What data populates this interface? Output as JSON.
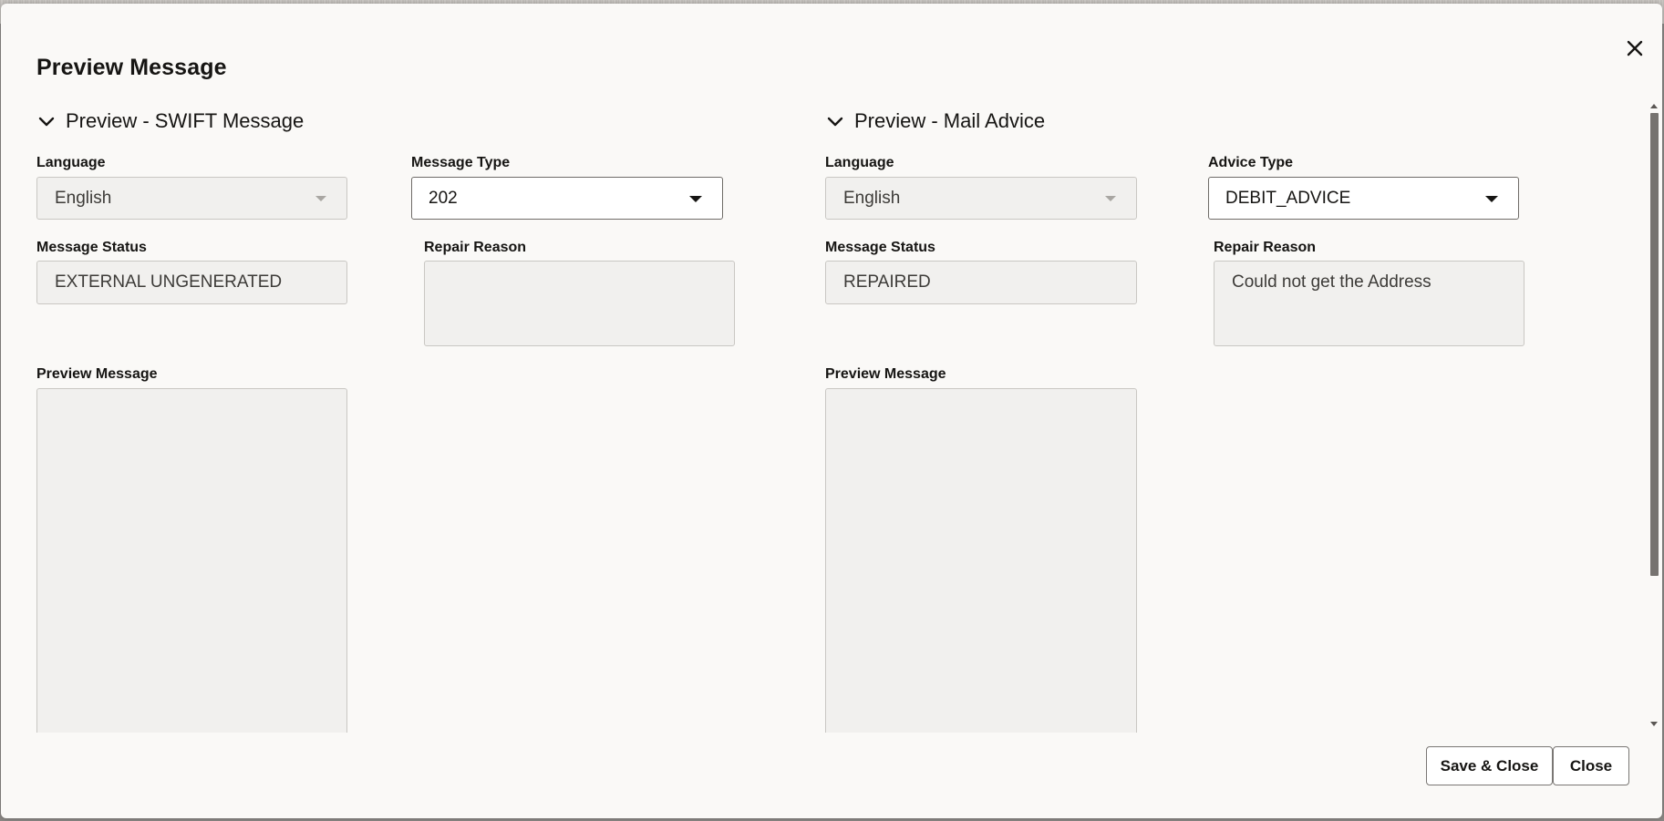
{
  "dialog": {
    "title": "Preview Message"
  },
  "swift": {
    "section_title": "Preview - SWIFT Message",
    "language_label": "Language",
    "language_value": "English",
    "message_type_label": "Message Type",
    "message_type_value": "202",
    "message_status_label": "Message Status",
    "message_status_value": "EXTERNAL UNGENERATED",
    "repair_reason_label": "Repair Reason",
    "repair_reason_value": "",
    "preview_label": "Preview Message"
  },
  "mail": {
    "section_title": "Preview - Mail Advice",
    "language_label": "Language",
    "language_value": "English",
    "advice_type_label": "Advice Type",
    "advice_type_value": "DEBIT_ADVICE",
    "message_status_label": "Message Status",
    "message_status_value": "REPAIRED",
    "repair_reason_label": "Repair Reason",
    "repair_reason_value": "Could not get the Address",
    "preview_label": "Preview Message"
  },
  "footer": {
    "save_close_label": "Save & Close",
    "close_label": "Close"
  },
  "icons": {
    "close": "close-icon",
    "section_toggle": "chevron-down-icon",
    "dropdown": "caret-down-icon"
  },
  "colors": {
    "dialog_bg": "#faf9f7",
    "readonly_field_bg": "#f1f0ee",
    "text": "#161513"
  }
}
